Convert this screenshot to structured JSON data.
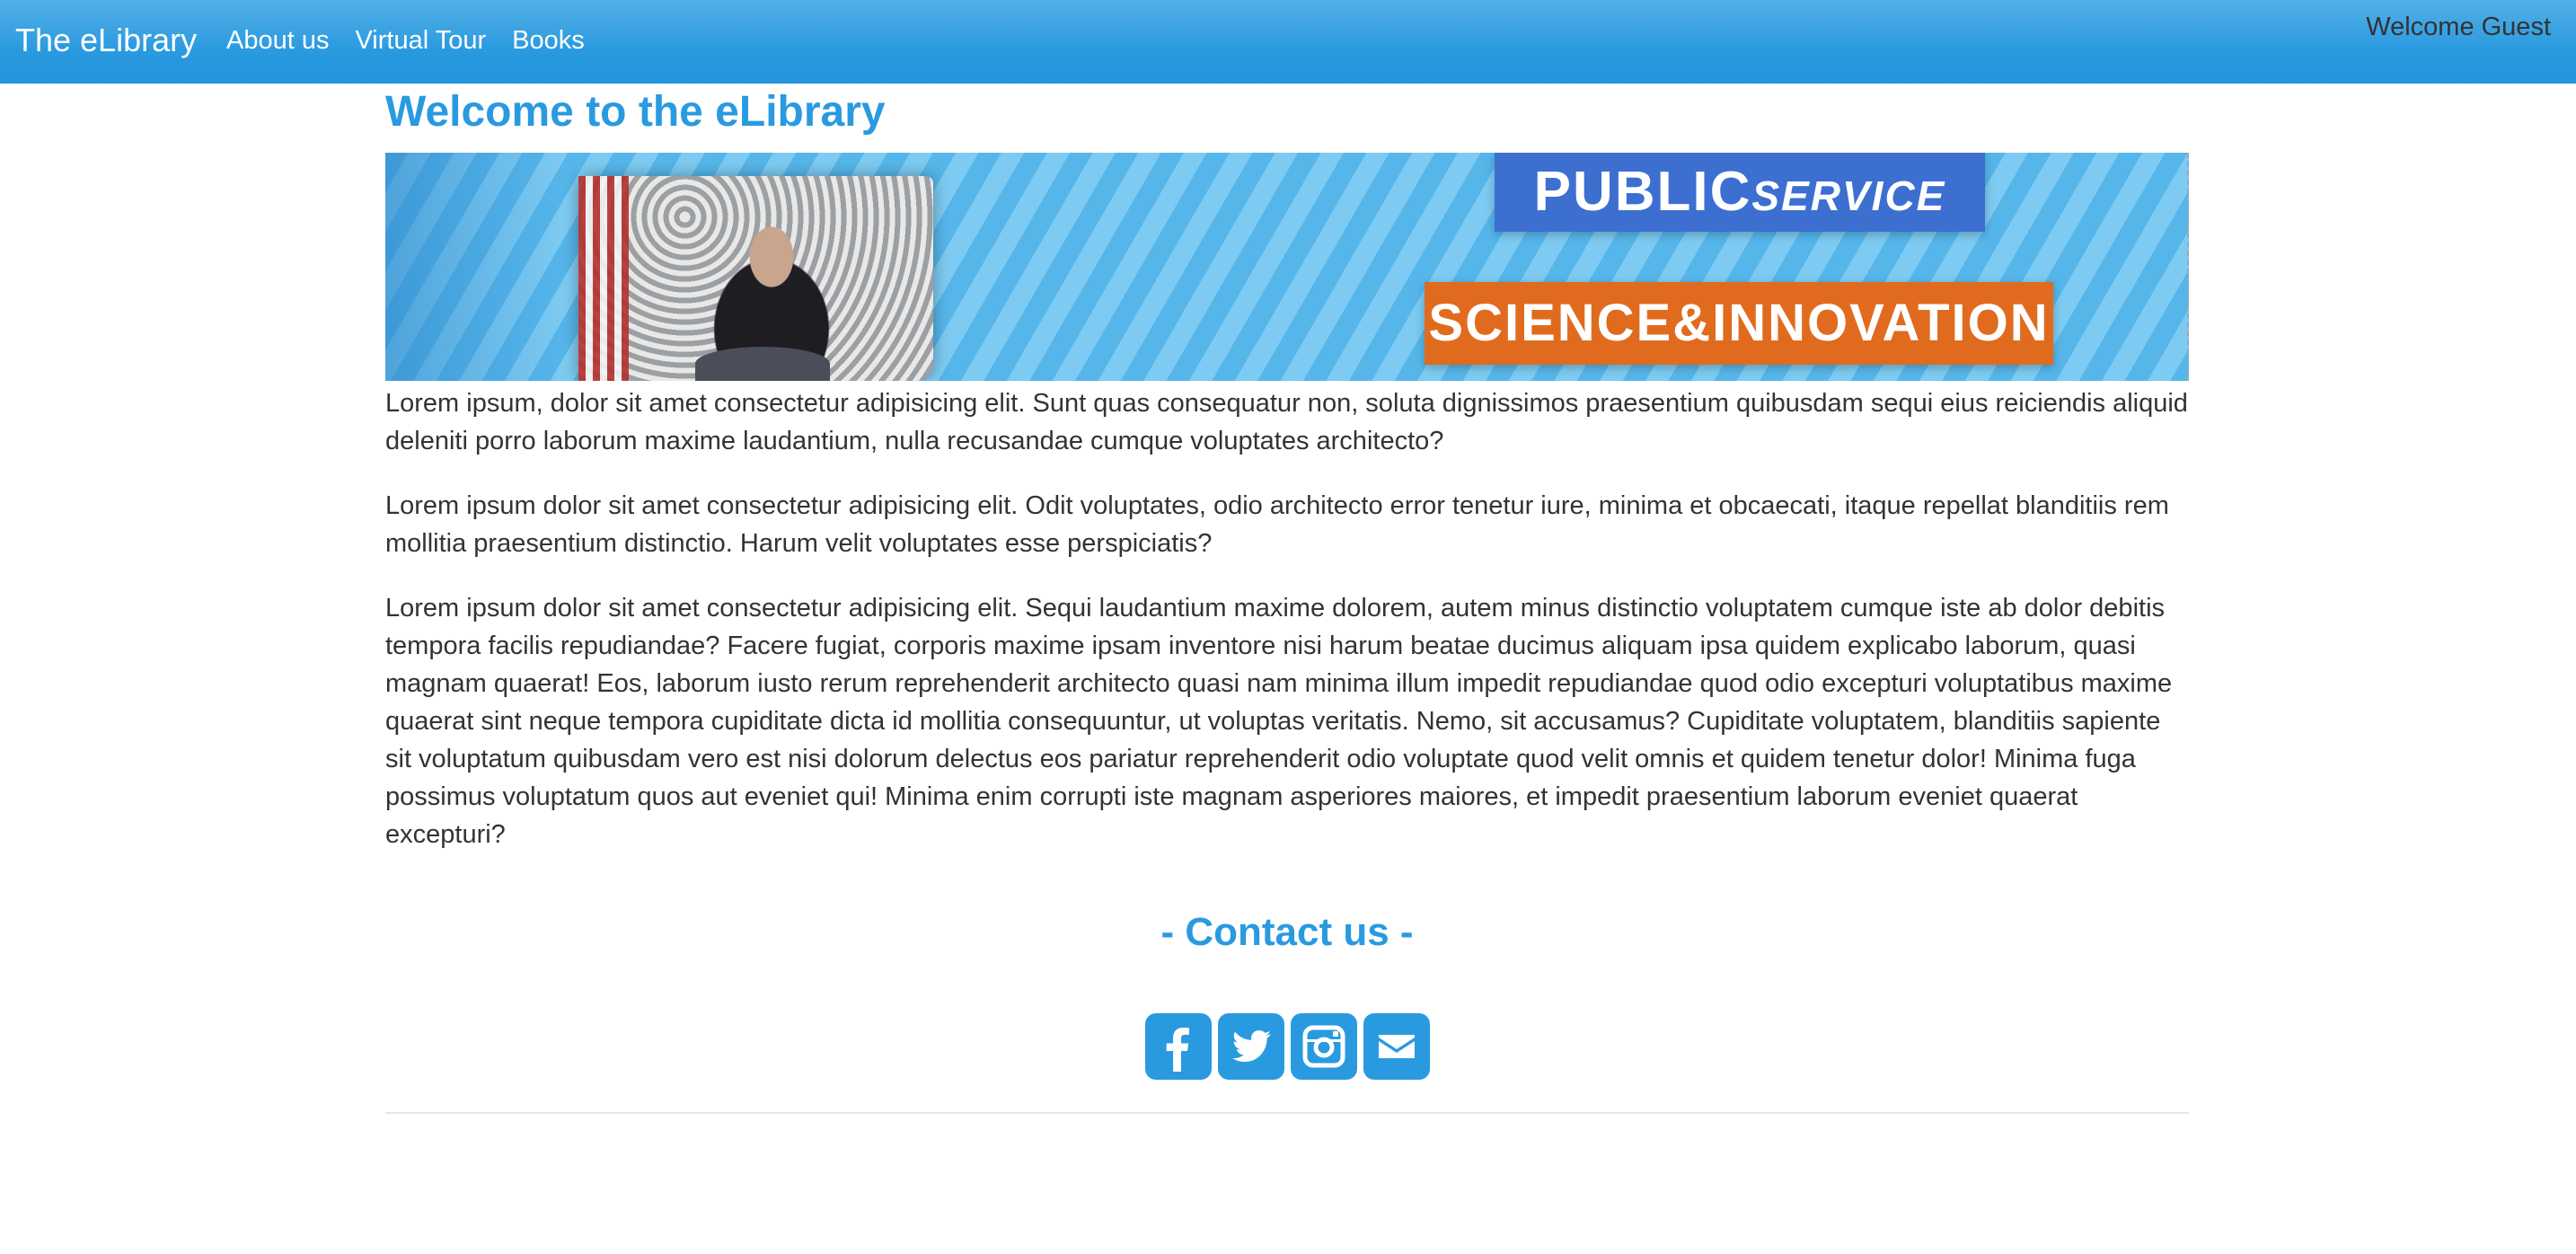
{
  "navbar": {
    "brand": "The eLibrary",
    "links": [
      "About us",
      "Virtual Tour",
      "Books"
    ],
    "welcome": "Welcome Guest"
  },
  "main": {
    "title": "Welcome to the eLibrary",
    "banner": {
      "tag_public": "PUBLIC",
      "tag_service": "SERVICE",
      "tag_science": "SCIENCE&INNOVATION"
    },
    "paragraphs": [
      "Lorem ipsum, dolor sit amet consectetur adipisicing elit. Sunt quas consequatur non, soluta dignissimos praesentium quibusdam sequi eius reiciendis aliquid deleniti porro laborum maxime laudantium, nulla recusandae cumque voluptates architecto?",
      "Lorem ipsum dolor sit amet consectetur adipisicing elit. Odit voluptates, odio architecto error tenetur iure, minima et obcaecati, itaque repellat blanditiis rem mollitia praesentium distinctio. Harum velit voluptates esse perspiciatis?",
      "Lorem ipsum dolor sit amet consectetur adipisicing elit. Sequi laudantium maxime dolorem, autem minus distinctio voluptatem cumque iste ab dolor debitis tempora facilis repudiandae? Facere fugiat, corporis maxime ipsam inventore nisi harum beatae ducimus aliquam ipsa quidem explicabo laborum, quasi magnam quaerat! Eos, laborum iusto rerum reprehenderit architecto quasi nam minima illum impedit repudiandae quod odio excepturi voluptatibus maxime quaerat sint neque tempora cupiditate dicta id mollitia consequuntur, ut voluptas veritatis. Nemo, sit accusamus? Cupiditate voluptatem, blanditiis sapiente sit voluptatum quibusdam vero est nisi dolorum delectus eos pariatur reprehenderit odio voluptate quod velit omnis et quidem tenetur dolor! Minima fuga possimus voluptatum quos aut eveniet qui! Minima enim corrupti iste magnam asperiores maiores, et impedit praesentium laborum eveniet quaerat excepturi?"
    ]
  },
  "contact": {
    "title": "- Contact us -",
    "icons": [
      "facebook-icon",
      "twitter-icon",
      "instagram-icon",
      "email-icon"
    ]
  },
  "colors": {
    "accent": "#2a9ae0",
    "navbar": "#3aa4e4",
    "text": "#333333"
  }
}
